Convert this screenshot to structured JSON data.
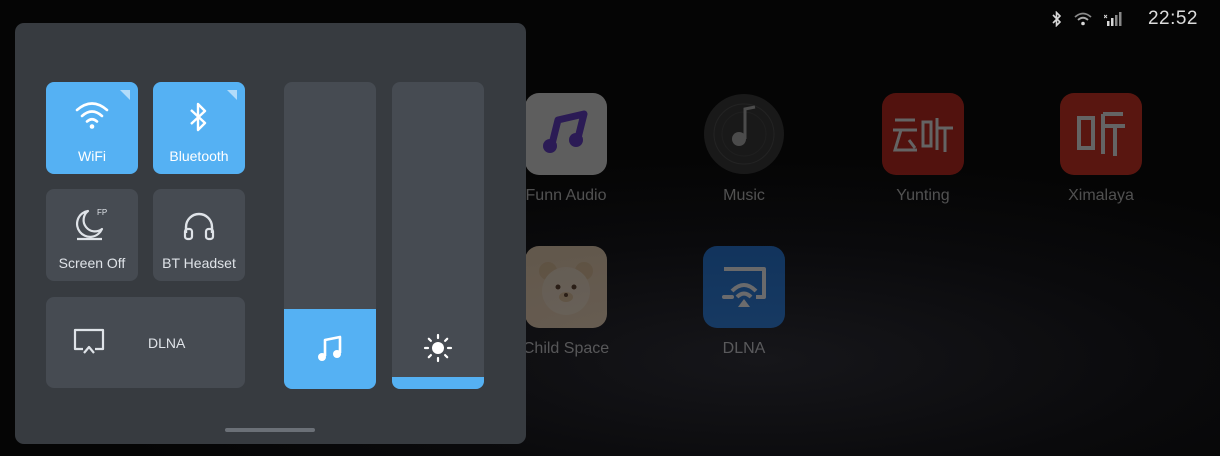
{
  "status_bar": {
    "icons": [
      "bluetooth-icon",
      "wifi-icon",
      "signal-icon"
    ],
    "time": "22:52"
  },
  "apps": [
    {
      "label": "Funn Audio",
      "icon": "music-note-icon",
      "color": "#eeeeee"
    },
    {
      "label": "Music",
      "icon": "vinyl-icon",
      "color": "#3a3a3a"
    },
    {
      "label": "Yunting",
      "icon": "yunting-logo",
      "color": "#d0291f"
    },
    {
      "label": "Ximalaya",
      "icon": "ximalaya-logo",
      "color": "#e23424"
    },
    {
      "label": "Child Space",
      "icon": "bear-icon",
      "color": "#f2d7b5"
    },
    {
      "label": "DLNA",
      "icon": "cast-icon",
      "color": "#1e78de"
    }
  ],
  "control_panel": {
    "tiles": [
      {
        "label": "WiFi",
        "icon": "wifi-icon",
        "active": true
      },
      {
        "label": "Bluetooth",
        "icon": "bluetooth-icon",
        "active": true
      },
      {
        "label": "Screen Off",
        "icon": "moon-fp-icon",
        "badge": "FP",
        "active": false
      },
      {
        "label": "BT Headset",
        "icon": "headphones-icon",
        "active": false
      }
    ],
    "dlna": {
      "label": "DLNA",
      "icon": "screen-cast-icon"
    },
    "volume": {
      "level": 0.26,
      "icon": "music-note-icon"
    },
    "brightness": {
      "level": 0.04,
      "icon": "sun-icon"
    },
    "accent_color": "#55b1f3"
  }
}
